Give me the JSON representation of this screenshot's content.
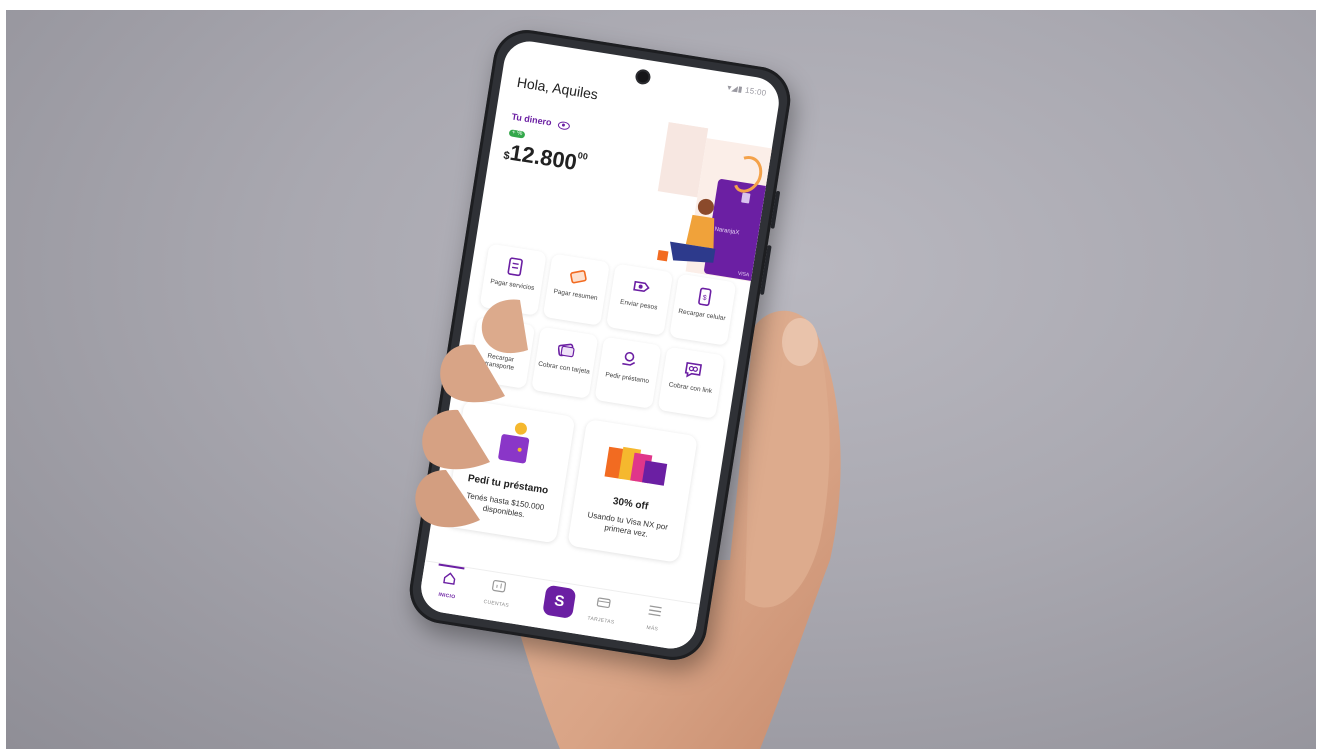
{
  "status": {
    "time": "15:00"
  },
  "greeting": "Hola, Aquiles",
  "money": {
    "label": "Tu dinero",
    "badge": "+ %",
    "currency": "$",
    "amount_int": "12.800",
    "amount_dec": "00"
  },
  "illustration": {
    "card_brand": "NaranjaX",
    "card_network": "VISA"
  },
  "actions": [
    {
      "label": "Pagar servicios",
      "icon": "bill-icon"
    },
    {
      "label": "Pagar resumen",
      "icon": "card-pay-icon"
    },
    {
      "label": "Enviar pesos",
      "icon": "send-money-icon"
    },
    {
      "label": "Recargar celular",
      "icon": "phone-recharge-icon"
    },
    {
      "label": "Recargar transporte",
      "icon": "transport-card-icon"
    },
    {
      "label": "Cobrar con tarjeta",
      "icon": "card-charge-icon"
    },
    {
      "label": "Pedir préstamo",
      "icon": "loan-icon"
    },
    {
      "label": "Cobrar con link",
      "icon": "link-icon"
    }
  ],
  "promos": [
    {
      "title": "Pedí tu préstamo",
      "subtitle": "Tenés hasta $150.000 disponibles."
    },
    {
      "title": "30% off",
      "subtitle": "Usando tu Visa NX por primera vez."
    }
  ],
  "tabs": [
    {
      "label": "INICIO",
      "icon": "home-icon"
    },
    {
      "label": "CUENTAS",
      "icon": "chart-icon"
    },
    {
      "label": "S",
      "icon": "s-logo-icon"
    },
    {
      "label": "TARJETAS",
      "icon": "card-icon"
    },
    {
      "label": "MÁS",
      "icon": "menu-icon"
    }
  ],
  "colors": {
    "brand": "#6b1fa3",
    "accent": "#f26b21",
    "success": "#33a84a"
  }
}
